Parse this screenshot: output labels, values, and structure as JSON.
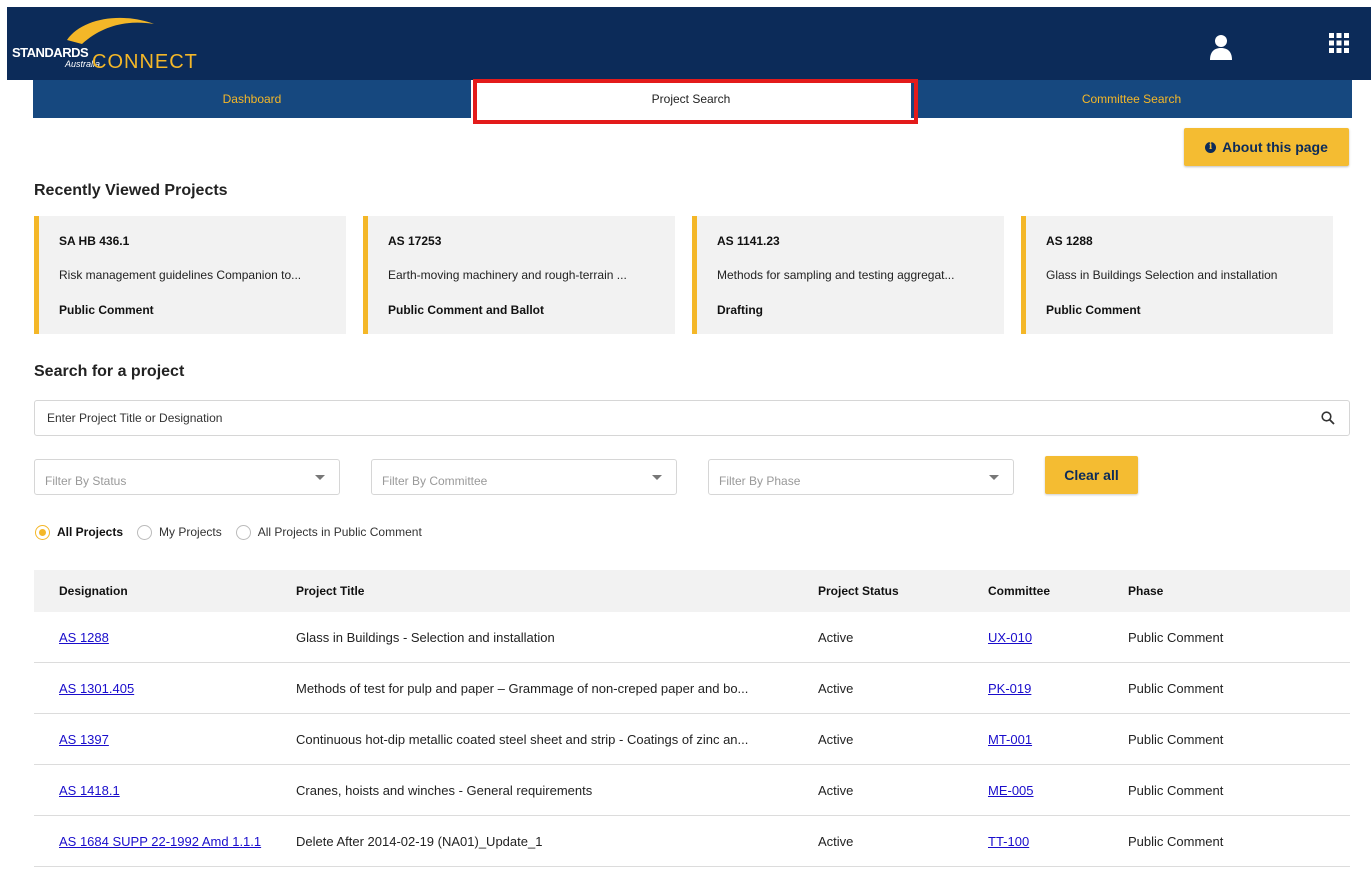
{
  "header": {
    "logo_line1": "STANDARDS",
    "logo_line2": "Australia",
    "logo_line3": "CONNECT",
    "icons": [
      "user-icon",
      "apps-grid-icon"
    ]
  },
  "tabs": [
    {
      "label": "Dashboard"
    },
    {
      "label": "Project Search",
      "active": true
    },
    {
      "label": "Committee Search"
    }
  ],
  "about_button": "About this page",
  "recent": {
    "title": "Recently Viewed Projects",
    "cards": [
      {
        "code": "SA HB 436.1",
        "title": "Risk management guidelines Companion to...",
        "phase": "Public Comment"
      },
      {
        "code": "AS 17253",
        "title": "Earth-moving machinery and rough-terrain ...",
        "phase": "Public Comment and Ballot"
      },
      {
        "code": "AS 1141.23",
        "title": "Methods for sampling and testing aggregat...",
        "phase": "Drafting"
      },
      {
        "code": "AS 1288",
        "title": "Glass in Buildings Selection and installation",
        "phase": "Public Comment"
      }
    ]
  },
  "search": {
    "title": "Search for a project",
    "placeholder": "Enter Project Title or Designation",
    "filters": [
      "Filter By Status",
      "Filter By Committee",
      "Filter By Phase"
    ],
    "clear_label": "Clear all",
    "radios": [
      {
        "label": "All Projects",
        "selected": true
      },
      {
        "label": "My Projects",
        "selected": false
      },
      {
        "label": "All Projects in Public Comment",
        "selected": false
      }
    ]
  },
  "table": {
    "columns": [
      "Designation",
      "Project Title",
      "Project Status",
      "Committee",
      "Phase"
    ],
    "rows": [
      {
        "designation": "AS 1288",
        "title": "Glass in Buildings - Selection and installation",
        "status": "Active",
        "committee": "UX-010",
        "phase": "Public Comment"
      },
      {
        "designation": "AS 1301.405",
        "title": "Methods of test for pulp and paper – Grammage of non-creped paper and bo...",
        "status": "Active",
        "committee": "PK-019",
        "phase": "Public Comment"
      },
      {
        "designation": "AS 1397",
        "title": "Continuous hot-dip metallic coated steel sheet and strip - Coatings of zinc an...",
        "status": "Active",
        "committee": "MT-001",
        "phase": "Public Comment"
      },
      {
        "designation": "AS 1418.1",
        "title": "Cranes, hoists and winches - General requirements",
        "status": "Active",
        "committee": "ME-005",
        "phase": "Public Comment"
      },
      {
        "designation": "AS 1684 SUPP 22-1992 Amd 1.1.1",
        "title": "Delete After 2014-02-19 (NA01)_Update_1",
        "status": "Active",
        "committee": "TT-100",
        "phase": "Public Comment"
      }
    ]
  },
  "colors": {
    "navy": "#0c2b59",
    "tab_blue": "#16487f",
    "accent": "#f4b728",
    "highlight": "#e31b1b"
  }
}
